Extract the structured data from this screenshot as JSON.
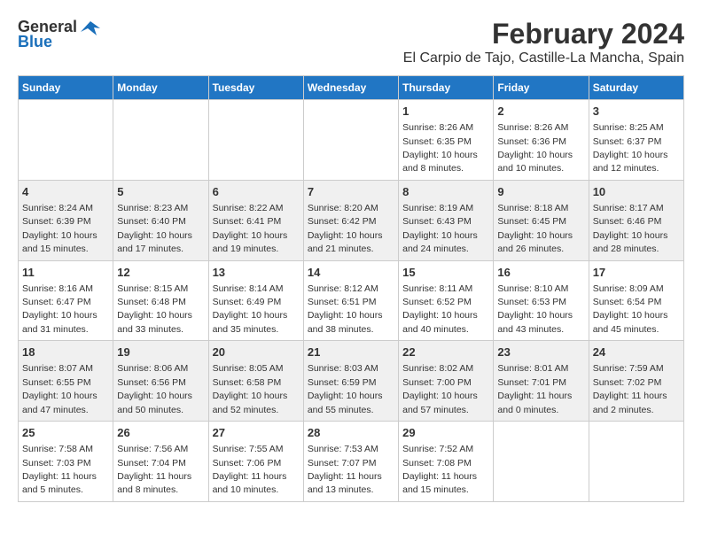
{
  "logo": {
    "general": "General",
    "blue": "Blue"
  },
  "title": "February 2024",
  "subtitle": "El Carpio de Tajo, Castille-La Mancha, Spain",
  "headers": [
    "Sunday",
    "Monday",
    "Tuesday",
    "Wednesday",
    "Thursday",
    "Friday",
    "Saturday"
  ],
  "weeks": [
    [
      {
        "day": "",
        "info": ""
      },
      {
        "day": "",
        "info": ""
      },
      {
        "day": "",
        "info": ""
      },
      {
        "day": "",
        "info": ""
      },
      {
        "day": "1",
        "info": "Sunrise: 8:26 AM\nSunset: 6:35 PM\nDaylight: 10 hours\nand 8 minutes."
      },
      {
        "day": "2",
        "info": "Sunrise: 8:26 AM\nSunset: 6:36 PM\nDaylight: 10 hours\nand 10 minutes."
      },
      {
        "day": "3",
        "info": "Sunrise: 8:25 AM\nSunset: 6:37 PM\nDaylight: 10 hours\nand 12 minutes."
      }
    ],
    [
      {
        "day": "4",
        "info": "Sunrise: 8:24 AM\nSunset: 6:39 PM\nDaylight: 10 hours\nand 15 minutes."
      },
      {
        "day": "5",
        "info": "Sunrise: 8:23 AM\nSunset: 6:40 PM\nDaylight: 10 hours\nand 17 minutes."
      },
      {
        "day": "6",
        "info": "Sunrise: 8:22 AM\nSunset: 6:41 PM\nDaylight: 10 hours\nand 19 minutes."
      },
      {
        "day": "7",
        "info": "Sunrise: 8:20 AM\nSunset: 6:42 PM\nDaylight: 10 hours\nand 21 minutes."
      },
      {
        "day": "8",
        "info": "Sunrise: 8:19 AM\nSunset: 6:43 PM\nDaylight: 10 hours\nand 24 minutes."
      },
      {
        "day": "9",
        "info": "Sunrise: 8:18 AM\nSunset: 6:45 PM\nDaylight: 10 hours\nand 26 minutes."
      },
      {
        "day": "10",
        "info": "Sunrise: 8:17 AM\nSunset: 6:46 PM\nDaylight: 10 hours\nand 28 minutes."
      }
    ],
    [
      {
        "day": "11",
        "info": "Sunrise: 8:16 AM\nSunset: 6:47 PM\nDaylight: 10 hours\nand 31 minutes."
      },
      {
        "day": "12",
        "info": "Sunrise: 8:15 AM\nSunset: 6:48 PM\nDaylight: 10 hours\nand 33 minutes."
      },
      {
        "day": "13",
        "info": "Sunrise: 8:14 AM\nSunset: 6:49 PM\nDaylight: 10 hours\nand 35 minutes."
      },
      {
        "day": "14",
        "info": "Sunrise: 8:12 AM\nSunset: 6:51 PM\nDaylight: 10 hours\nand 38 minutes."
      },
      {
        "day": "15",
        "info": "Sunrise: 8:11 AM\nSunset: 6:52 PM\nDaylight: 10 hours\nand 40 minutes."
      },
      {
        "day": "16",
        "info": "Sunrise: 8:10 AM\nSunset: 6:53 PM\nDaylight: 10 hours\nand 43 minutes."
      },
      {
        "day": "17",
        "info": "Sunrise: 8:09 AM\nSunset: 6:54 PM\nDaylight: 10 hours\nand 45 minutes."
      }
    ],
    [
      {
        "day": "18",
        "info": "Sunrise: 8:07 AM\nSunset: 6:55 PM\nDaylight: 10 hours\nand 47 minutes."
      },
      {
        "day": "19",
        "info": "Sunrise: 8:06 AM\nSunset: 6:56 PM\nDaylight: 10 hours\nand 50 minutes."
      },
      {
        "day": "20",
        "info": "Sunrise: 8:05 AM\nSunset: 6:58 PM\nDaylight: 10 hours\nand 52 minutes."
      },
      {
        "day": "21",
        "info": "Sunrise: 8:03 AM\nSunset: 6:59 PM\nDaylight: 10 hours\nand 55 minutes."
      },
      {
        "day": "22",
        "info": "Sunrise: 8:02 AM\nSunset: 7:00 PM\nDaylight: 10 hours\nand 57 minutes."
      },
      {
        "day": "23",
        "info": "Sunrise: 8:01 AM\nSunset: 7:01 PM\nDaylight: 11 hours\nand 0 minutes."
      },
      {
        "day": "24",
        "info": "Sunrise: 7:59 AM\nSunset: 7:02 PM\nDaylight: 11 hours\nand 2 minutes."
      }
    ],
    [
      {
        "day": "25",
        "info": "Sunrise: 7:58 AM\nSunset: 7:03 PM\nDaylight: 11 hours\nand 5 minutes."
      },
      {
        "day": "26",
        "info": "Sunrise: 7:56 AM\nSunset: 7:04 PM\nDaylight: 11 hours\nand 8 minutes."
      },
      {
        "day": "27",
        "info": "Sunrise: 7:55 AM\nSunset: 7:06 PM\nDaylight: 11 hours\nand 10 minutes."
      },
      {
        "day": "28",
        "info": "Sunrise: 7:53 AM\nSunset: 7:07 PM\nDaylight: 11 hours\nand 13 minutes."
      },
      {
        "day": "29",
        "info": "Sunrise: 7:52 AM\nSunset: 7:08 PM\nDaylight: 11 hours\nand 15 minutes."
      },
      {
        "day": "",
        "info": ""
      },
      {
        "day": "",
        "info": ""
      }
    ]
  ]
}
